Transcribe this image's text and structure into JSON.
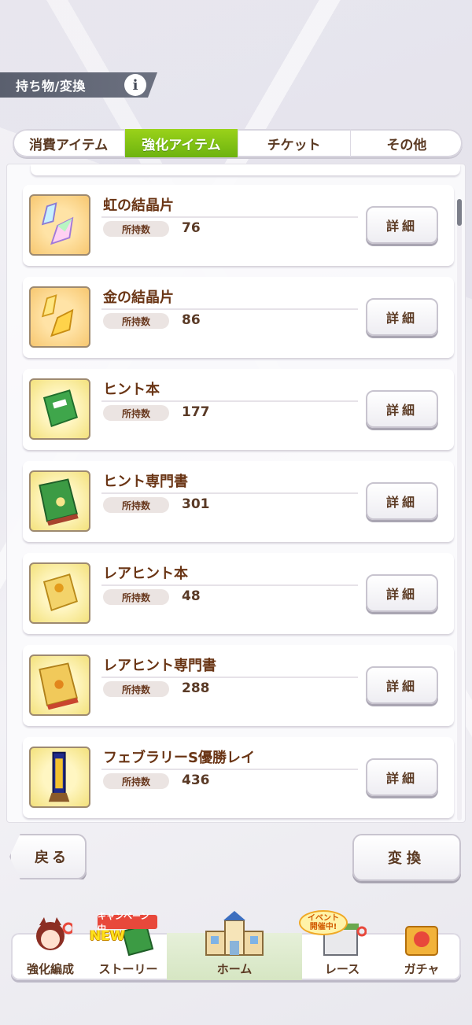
{
  "header": {
    "title": "持ち物/変換",
    "info_icon": "i"
  },
  "tabs": [
    {
      "label": "消費アイテム",
      "active": false
    },
    {
      "label": "強化アイテム",
      "active": true
    },
    {
      "label": "チケット",
      "active": false
    },
    {
      "label": "その他",
      "active": false
    }
  ],
  "qty_label": "所持数",
  "detail_label": "詳細",
  "items": [
    {
      "name": "虹の結晶片",
      "qty": "76",
      "icon": "rainbow-crystal-icon"
    },
    {
      "name": "金の結晶片",
      "qty": "86",
      "icon": "gold-crystal-icon"
    },
    {
      "name": "ヒント本",
      "qty": "177",
      "icon": "hint-book-icon"
    },
    {
      "name": "ヒント専門書",
      "qty": "301",
      "icon": "hint-specialty-book-icon"
    },
    {
      "name": "レアヒント本",
      "qty": "48",
      "icon": "rare-hint-book-icon"
    },
    {
      "name": "レアヒント専門書",
      "qty": "288",
      "icon": "rare-hint-specialty-book-icon"
    },
    {
      "name": "フェブラリーS優勝レイ",
      "qty": "436",
      "icon": "victory-lei-icon"
    }
  ],
  "buttons": {
    "back": "戻る",
    "convert": "変換"
  },
  "nav": [
    {
      "label": "強化編成"
    },
    {
      "label": "ストーリー",
      "badge": "キャンペーン中",
      "badge2": "NEW"
    },
    {
      "label": "ホーム"
    },
    {
      "label": "レース",
      "badge_line1": "イベント",
      "badge_line2": "開催中!"
    },
    {
      "label": "ガチャ"
    }
  ],
  "colors": {
    "tab_active": "#7cc012",
    "text_brown": "#6a3515",
    "header_bg": "#5a5f6e"
  }
}
